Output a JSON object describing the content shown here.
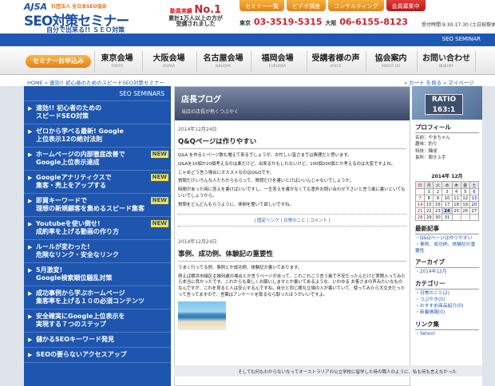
{
  "header": {
    "logo_small": "社団法人 全日本SEO協会",
    "logo_ajsa": "AJSA",
    "logo_main": "SEO対策セミナー",
    "logo_tag": "自分で出来る!! ＳＥＯ対策",
    "record_line1": "動員実績",
    "record_no1": "No.1",
    "record_line2": "累計1万人以上の方が",
    "record_line3": "受講されました",
    "top_buttons": [
      "セミナー一覧",
      "ビデオ講座",
      "コンサルティング",
      "会員募集中"
    ],
    "phone_tokyo_label": "東京",
    "phone_tokyo": "03-3519-5315",
    "phone_osaka_label": "大阪",
    "phone_osaka": "06-6155-8123",
    "hours": "受付時間 9:30-17:30 (土日祝祭休)"
  },
  "bluebar": {
    "label": "SEO SEMINAR"
  },
  "nav": {
    "apply": "セミナーお申込み",
    "items": [
      {
        "jp": "東京会場",
        "en": "TOKYO"
      },
      {
        "jp": "大阪会場",
        "en": "OSAKA"
      },
      {
        "jp": "名古屋会場",
        "en": "NAGOYA"
      },
      {
        "jp": "福岡会場",
        "en": "FUKUOKA"
      },
      {
        "jp": "受講者様の声",
        "en": "VOICE"
      },
      {
        "jp": "協会案内",
        "en": "ABOUT US"
      },
      {
        "jp": "お問い合わせ",
        "en": "INQUIRY"
      }
    ]
  },
  "breadcrumb": {
    "path": "HOME » 速効!! 初心者のためのスピードSEO対策セミナー",
    "right": "» カート を見る  » マイページ"
  },
  "sidebar": {
    "title": "SEO SEMINARS",
    "items": [
      {
        "text": "速効!! 初心者のための\nスピードSEO対策",
        "new": ""
      },
      {
        "text": "ゼロから学べる最新! Google\n上位表示12の絶対法則",
        "new": ""
      },
      {
        "text": "ホームページの内部徹底改善で\nGoogle上位表示達成",
        "new": "NEW"
      },
      {
        "text": "Googleアナリティクスで\n集客・売上をアップする",
        "new": "NEW"
      },
      {
        "text": "即買キーワードで\n理想の新規顧客を集めるスピード集客",
        "new": "NEW"
      },
      {
        "text": "Youtubeを使い倒せ!\n成約率を上げる動画の作り方",
        "new": "NEW"
      },
      {
        "text": "ルールが変わった!\n危険なリンク・安全なリンク",
        "new": ""
      },
      {
        "text": "5月激変!\nGoogle検索順位騒乱対策",
        "new": ""
      },
      {
        "text": "成功事例から学ぶホームページ\n集客率を上げる１０の必須コンテンツ",
        "new": ""
      },
      {
        "text": "安全確実にGoogle上位表示を\n実現する７つのステップ",
        "new": ""
      },
      {
        "text": "儲かるSEOキーワード発見",
        "new": ""
      },
      {
        "text": "SEOの要らないアクセスアップ",
        "new": ""
      }
    ]
  },
  "blog": {
    "title": "店長ブログ",
    "subtitle": "当店の店長が熱くつぶやく",
    "posts": [
      {
        "date": "2014年12月24日",
        "title": "Q&Qページは作りやすい",
        "paragraphs": [
          "Q&A を作るとページ数も増えて来るでしょうが、お忙しい皆さまでは無理だと思います。",
          "Q&Aを10個か20個考えるのは楽だけど、出来るかもしれないけど、100個200個とか考えるのは大変ですよね。",
          "じゃあどう言う場合にオススメなのはQ&Qです。",
          "質問だけいろんな人たちからもらって、質問だけを書いとけばいいんじゃないでしょうか。",
          "時間があった時に答えを書けばいいですし、一生答えを書かなくても意外お問い合わせ下さいと言う風に書いといてもいいでしょうから。",
          "質問をどんどんもらうように、体制を整いて欲しいですね。"
        ],
        "links": "| 固定リンク | 日常のこと | コメント |"
      },
      {
        "date": "2014年12月24日",
        "title": "事例、成功例、体験記の重要性",
        "paragraphs": [
          "うまく行ってる例、事例とか成功例、体験記が書いてあります。",
          "例えば横浜市緑区主婦何歳の場合とか言うページがあって、これこれこう言う風で不安だったんだけど実際入ってみたら本当に良かったです。これからも楽しくお願いしますとか書いてあるような、いわゆる お客さまの声みたいなものなんですが、これを見ると人は安心するんですね。自分と同じ様な立場の人が書いていて、使ってみたら大丈夫だったって言ってますので、言葉はアンケートを取るなら取ったほうがいいですよ。"
        ]
      }
    ]
  },
  "right": {
    "sign_line1": "RATIO",
    "sign_line2": "163:1",
    "profile_title": "プロフィール",
    "profile_lines": [
      "名前：やまちゃん",
      "趣味：釣り",
      "特技：錬成",
      "長所：聞き上手"
    ],
    "calendar_title": "2014年 12月",
    "calendar_head": [
      "日",
      "月",
      "火",
      "水",
      "木",
      "金",
      "土"
    ],
    "calendar_rows": [
      [
        "",
        "1",
        "2",
        "3",
        "4",
        "5",
        "6"
      ],
      [
        "7",
        "8",
        "9",
        "10",
        "11",
        "12",
        "13"
      ],
      [
        "14",
        "15",
        "16",
        "17",
        "18",
        "19",
        "20"
      ],
      [
        "21",
        "22",
        "23",
        "24",
        "25",
        "26",
        "27"
      ],
      [
        "28",
        "29",
        "30",
        "31",
        "",
        "",
        ""
      ]
    ],
    "recent_title": "最新記事",
    "recent_items": [
      "Q&Qページは作りやすい",
      "事例、成功例、体験記の重要性"
    ],
    "archive_title": "アーカイブ",
    "archive_items": [
      "2014年12月"
    ],
    "category_title": "カテゴリー",
    "category_items": [
      "日常のこと(2)",
      "つぶやき(0)",
      "おすすめ商品紹介(0)",
      "新着情報(0)"
    ],
    "links_title": "リンク集",
    "links_items": [
      "Yahoo!"
    ]
  },
  "footer": {
    "text": "そしても何もわからないなってオーストラリアの公立学校に留学した時の職人のように、私も何も言えなかった"
  }
}
